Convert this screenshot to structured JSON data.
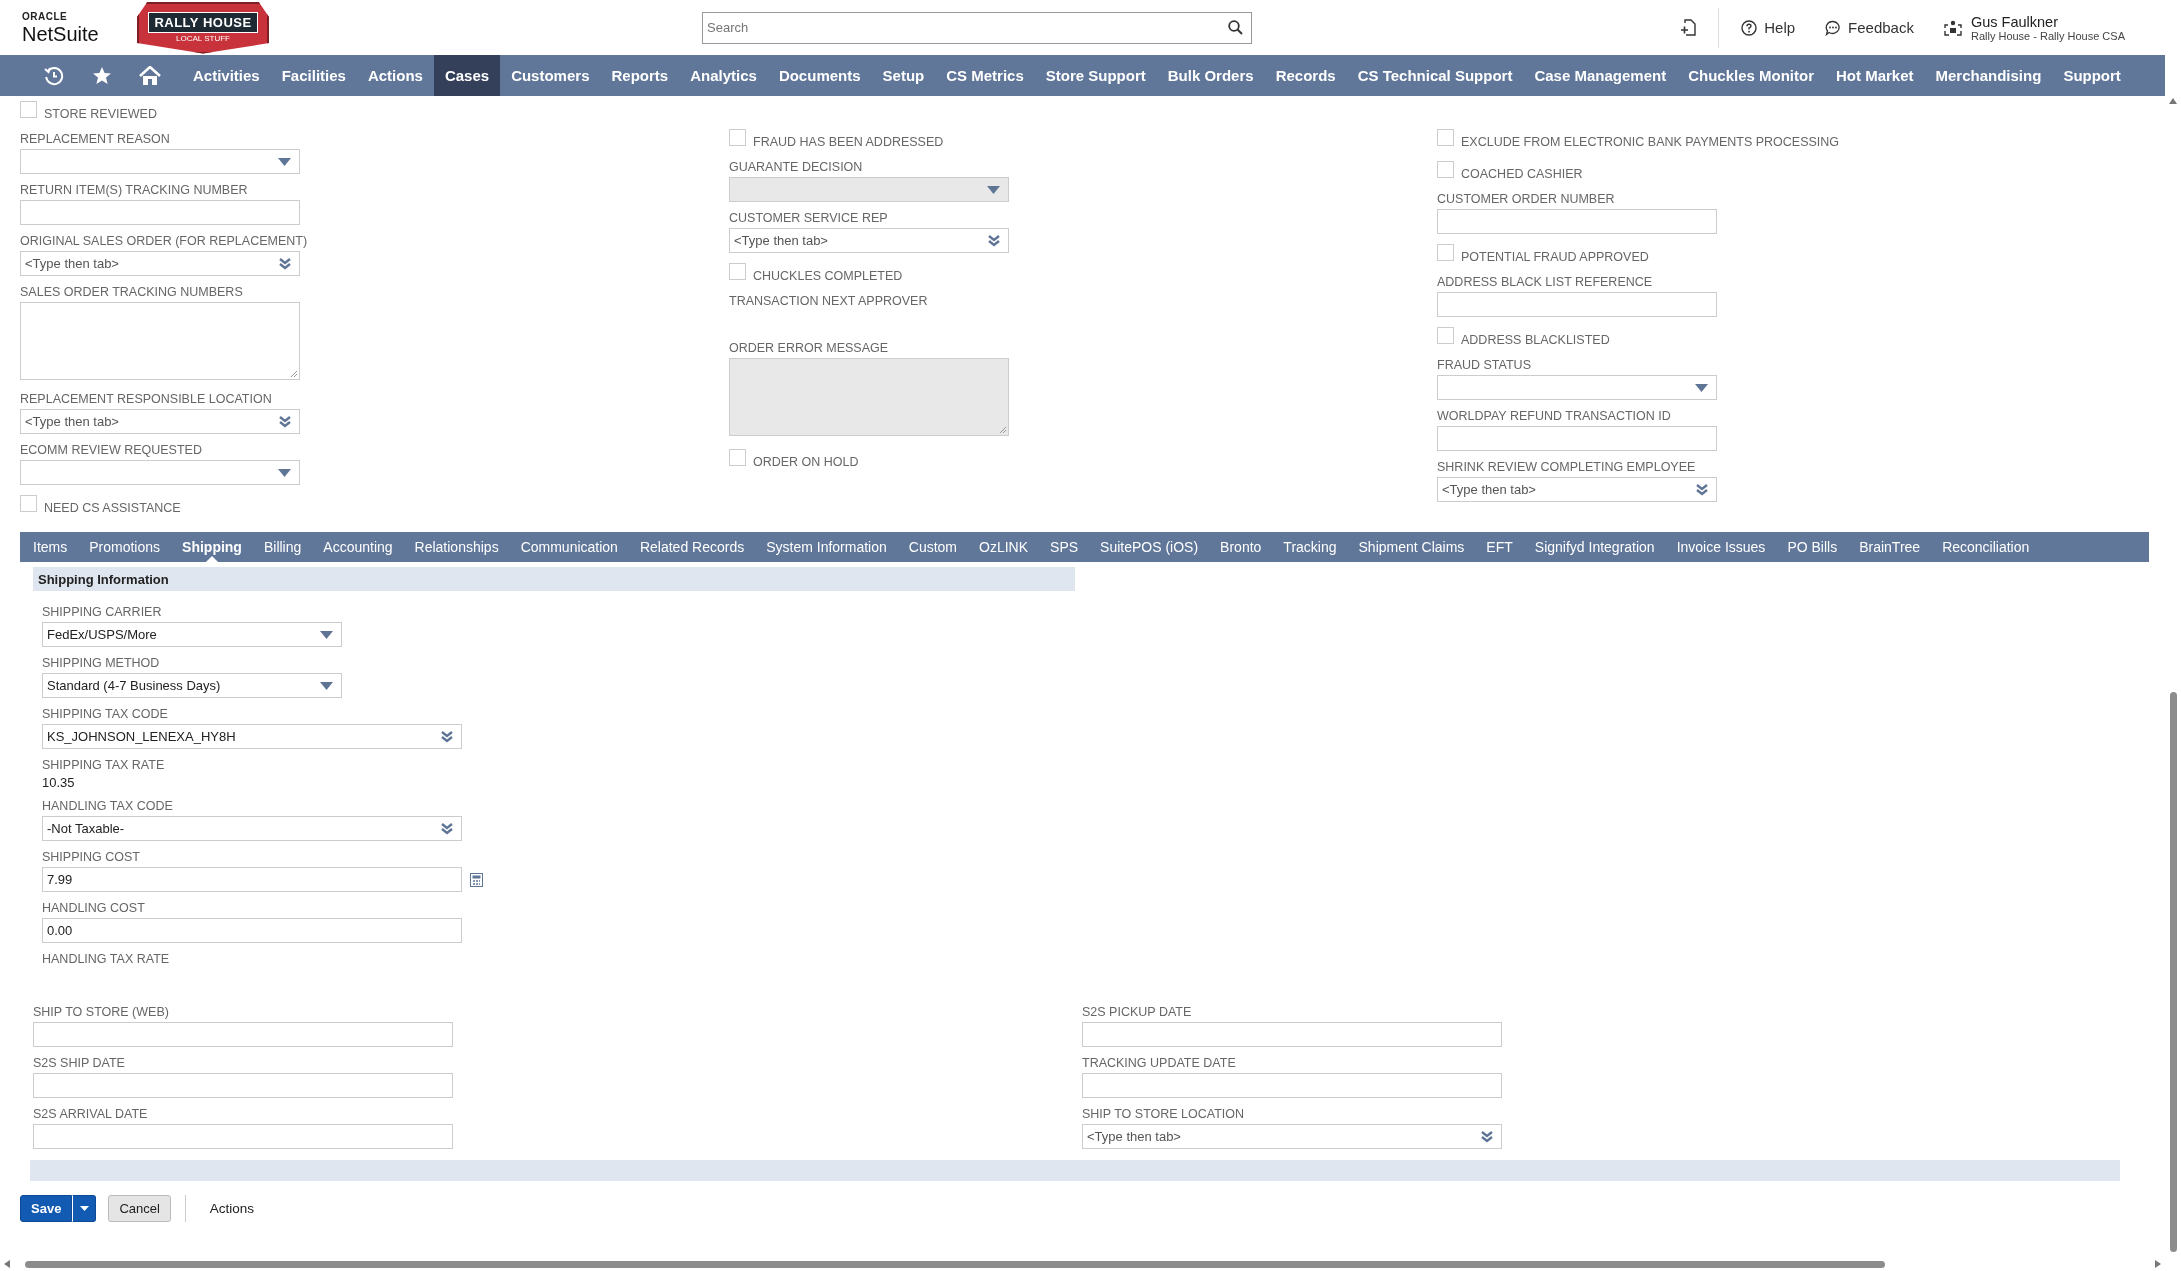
{
  "header": {
    "oracle": "ORACLE",
    "product": "NetSuite",
    "brand": "RALLY HOUSE",
    "brand_tagline": "LOCAL STUFF",
    "search": {
      "placeholder": "Search"
    },
    "help": "Help",
    "feedback": "Feedback",
    "user": {
      "name": "Gus Faulkner",
      "role": "Rally House - Rally House CSA"
    }
  },
  "nav": [
    {
      "label": "Activities",
      "selected": false
    },
    {
      "label": "Facilities",
      "selected": false
    },
    {
      "label": "Actions",
      "selected": false
    },
    {
      "label": "Cases",
      "selected": true
    },
    {
      "label": "Customers",
      "selected": false
    },
    {
      "label": "Reports",
      "selected": false
    },
    {
      "label": "Analytics",
      "selected": false
    },
    {
      "label": "Documents",
      "selected": false
    },
    {
      "label": "Setup",
      "selected": false
    },
    {
      "label": "CS Metrics",
      "selected": false
    },
    {
      "label": "Store Support",
      "selected": false
    },
    {
      "label": "Bulk Orders",
      "selected": false
    },
    {
      "label": "Records",
      "selected": false
    },
    {
      "label": "CS Technical Support",
      "selected": false
    },
    {
      "label": "Case Management",
      "selected": false
    },
    {
      "label": "Chuckles Monitor",
      "selected": false
    },
    {
      "label": "Hot Market",
      "selected": false
    },
    {
      "label": "Merchandising",
      "selected": false
    },
    {
      "label": "Support",
      "selected": false
    }
  ],
  "form_columns": [
    [
      {
        "kind": "checkbox",
        "label": "STORE REVIEWED",
        "checked": false
      },
      {
        "kind": "select",
        "label": "REPLACEMENT REASON",
        "disabled": false
      },
      {
        "kind": "text",
        "label": "RETURN ITEM(S) TRACKING NUMBER",
        "disabled": false
      },
      {
        "kind": "lookup",
        "label": "ORIGINAL SALES ORDER (FOR REPLACEMENT)",
        "placeholder": "<Type then tab>",
        "disabled": false
      },
      {
        "kind": "textarea",
        "label": "SALES ORDER TRACKING NUMBERS",
        "disabled": false
      },
      {
        "kind": "lookup",
        "label": "REPLACEMENT RESPONSIBLE LOCATION",
        "placeholder": "<Type then tab>",
        "disabled": false
      },
      {
        "kind": "select",
        "label": "ECOMM REVIEW REQUESTED",
        "disabled": false
      },
      {
        "kind": "checkbox",
        "label": "NEED CS ASSISTANCE",
        "checked": false
      }
    ],
    [
      {
        "kind": "checkbox",
        "label": "FRAUD HAS BEEN ADDRESSED",
        "checked": false
      },
      {
        "kind": "select",
        "label": "GUARANTE DECISION",
        "disabled": true
      },
      {
        "kind": "lookup",
        "label": "CUSTOMER SERVICE REP",
        "placeholder": "<Type then tab>",
        "disabled": false
      },
      {
        "kind": "checkbox",
        "label": "CHUCKLES COMPLETED",
        "checked": false
      },
      {
        "kind": "display",
        "label": "TRANSACTION NEXT APPROVER"
      },
      {
        "kind": "textarea",
        "label": "ORDER ERROR MESSAGE",
        "disabled": true
      },
      {
        "kind": "checkbox",
        "label": "ORDER ON HOLD",
        "checked": false
      }
    ],
    [
      {
        "kind": "checkbox",
        "label": "EXCLUDE FROM ELECTRONIC BANK PAYMENTS PROCESSING",
        "checked": false
      },
      {
        "kind": "checkbox",
        "label": "COACHED CASHIER",
        "checked": false
      },
      {
        "kind": "text",
        "label": "CUSTOMER ORDER NUMBER",
        "disabled": false
      },
      {
        "kind": "checkbox",
        "label": "POTENTIAL FRAUD APPROVED",
        "checked": false
      },
      {
        "kind": "text",
        "label": "ADDRESS BLACK LIST REFERENCE",
        "disabled": false
      },
      {
        "kind": "checkbox",
        "label": "ADDRESS BLACKLISTED",
        "checked": false
      },
      {
        "kind": "select",
        "label": "FRAUD STATUS",
        "disabled": false
      },
      {
        "kind": "text",
        "label": "WORLDPAY REFUND TRANSACTION ID",
        "disabled": false
      },
      {
        "kind": "lookup",
        "label": "SHRINK REVIEW COMPLETING EMPLOYEE",
        "placeholder": "<Type then tab>",
        "disabled": false
      }
    ]
  ],
  "subtabs": [
    {
      "label": "Items",
      "selected": false
    },
    {
      "label": "Promotions",
      "selected": false
    },
    {
      "label": "Shipping",
      "selected": true
    },
    {
      "label": "Billing",
      "selected": false
    },
    {
      "label": "Accounting",
      "selected": false
    },
    {
      "label": "Relationships",
      "selected": false
    },
    {
      "label": "Communication",
      "selected": false
    },
    {
      "label": "Related Records",
      "selected": false
    },
    {
      "label": "System Information",
      "selected": false
    },
    {
      "label": "Custom",
      "selected": false
    },
    {
      "label": "OzLINK",
      "selected": false
    },
    {
      "label": "SPS",
      "selected": false
    },
    {
      "label": "SuitePOS (iOS)",
      "selected": false
    },
    {
      "label": "Bronto",
      "selected": false
    },
    {
      "label": "Tracking",
      "selected": false
    },
    {
      "label": "Shipment Claims",
      "selected": false
    },
    {
      "label": "EFT",
      "selected": false
    },
    {
      "label": "Signifyd Integration",
      "selected": false
    },
    {
      "label": "Invoice Issues",
      "selected": false
    },
    {
      "label": "PO Bills",
      "selected": false
    },
    {
      "label": "BrainTree",
      "selected": false
    },
    {
      "label": "Reconciliation",
      "selected": false
    }
  ],
  "shipping": {
    "title": "Shipping Information",
    "fields": [
      {
        "kind": "select",
        "label": "SHIPPING CARRIER",
        "value": "FedEx/USPS/More",
        "disabled": false
      },
      {
        "kind": "select",
        "label": "SHIPPING METHOD",
        "value": "Standard (4-7 Business Days)",
        "disabled": false
      },
      {
        "kind": "lookup",
        "label": "SHIPPING TAX CODE",
        "value": "KS_JOHNSON_LENEXA_HY8H",
        "disabled": false
      },
      {
        "kind": "display",
        "label": "SHIPPING TAX RATE",
        "value": "10.35"
      },
      {
        "kind": "lookup",
        "label": "HANDLING TAX CODE",
        "value": "-Not Taxable-",
        "disabled": false
      },
      {
        "kind": "currency",
        "label": "SHIPPING COST",
        "value": "7.99",
        "disabled": false
      },
      {
        "kind": "text",
        "label": "HANDLING COST",
        "value": "0.00",
        "disabled": false
      },
      {
        "kind": "display",
        "label": "HANDLING TAX RATE"
      }
    ],
    "columns": [
      [
        {
          "kind": "text",
          "label": "SHIP TO STORE (WEB)",
          "disabled": false
        },
        {
          "kind": "text",
          "label": "S2S SHIP DATE",
          "disabled": false
        },
        {
          "kind": "text",
          "label": "S2S ARRIVAL DATE",
          "disabled": false
        }
      ],
      [
        {
          "kind": "text",
          "label": "S2S PICKUP DATE",
          "disabled": false
        },
        {
          "kind": "text",
          "label": "TRACKING UPDATE DATE",
          "disabled": false
        },
        {
          "kind": "lookup",
          "label": "SHIP TO STORE LOCATION",
          "placeholder": "<Type then tab>",
          "disabled": false
        }
      ]
    ]
  },
  "footer": {
    "save": "Save",
    "cancel": "Cancel",
    "actions": "Actions"
  }
}
